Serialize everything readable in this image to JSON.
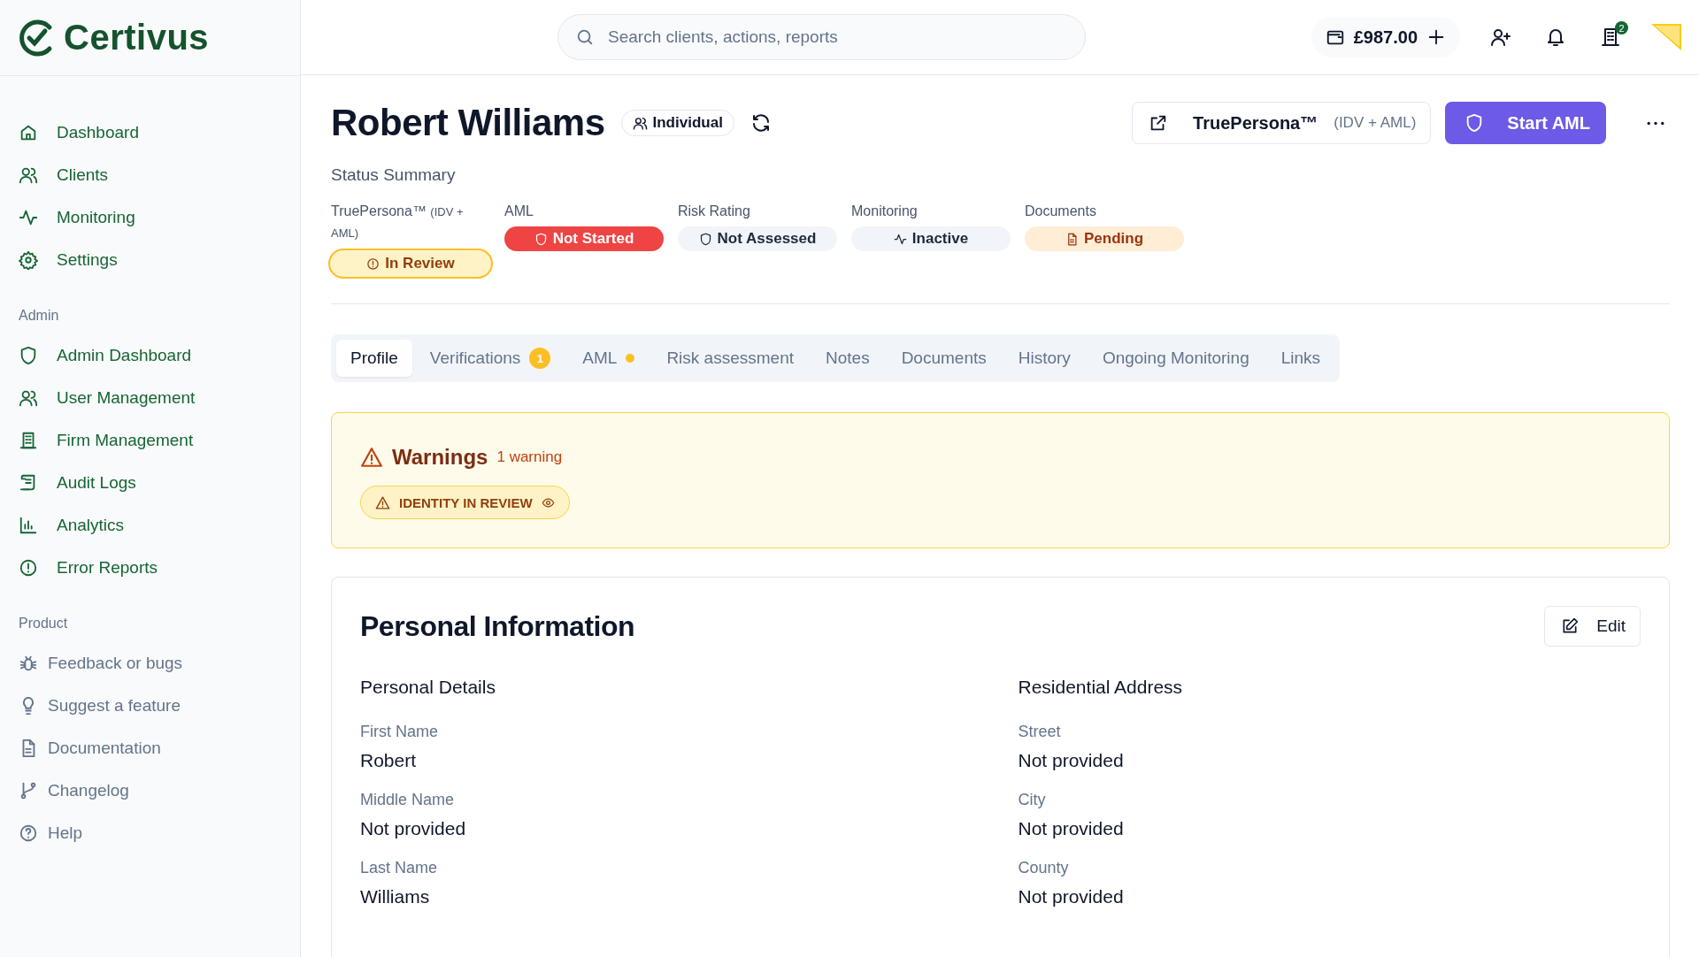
{
  "logo": {
    "text": "Certivus"
  },
  "sidebar": {
    "sections": [
      {
        "kind": "primary",
        "items": [
          {
            "label": "Dashboard"
          },
          {
            "label": "Clients"
          },
          {
            "label": "Monitoring"
          },
          {
            "label": "Settings"
          }
        ]
      },
      {
        "kind": "primary",
        "title": "Admin",
        "items": [
          {
            "label": "Admin Dashboard"
          },
          {
            "label": "User Management"
          },
          {
            "label": "Firm Management"
          },
          {
            "label": "Audit Logs"
          },
          {
            "label": "Analytics"
          },
          {
            "label": "Error Reports"
          }
        ]
      },
      {
        "kind": "secondary",
        "title": "Product",
        "items": [
          {
            "label": "Feedback or bugs"
          },
          {
            "label": "Suggest a feature"
          },
          {
            "label": "Documentation"
          },
          {
            "label": "Changelog"
          },
          {
            "label": "Help"
          }
        ]
      }
    ]
  },
  "topbar": {
    "search": {
      "placeholder": "Search clients, actions, reports"
    },
    "balance": "£987.00",
    "notification_count": "2"
  },
  "header": {
    "name": "Robert Williams",
    "type": "Individual",
    "truepersona": {
      "label": "TruePersona™",
      "note": "(IDV + AML)"
    },
    "primary_action": "Start AML"
  },
  "status_summary": {
    "title": "Status Summary",
    "items": [
      {
        "label": "TruePersona™",
        "note": "(IDV + AML)",
        "status": "In Review",
        "kind": "review"
      },
      {
        "label": "AML",
        "status": "Not Started",
        "kind": "danger"
      },
      {
        "label": "Risk Rating",
        "status": "Not Assessed",
        "kind": "neutral-shield"
      },
      {
        "label": "Monitoring",
        "status": "Inactive",
        "kind": "neutral-activity"
      },
      {
        "label": "Documents",
        "status": "Pending",
        "kind": "pending"
      }
    ]
  },
  "tabs": [
    {
      "label": "Profile",
      "selected": true,
      "dot": false
    },
    {
      "label": "Verifications",
      "selected": false,
      "badge": "1",
      "dot": false
    },
    {
      "label": "AML",
      "selected": false,
      "dot": true
    },
    {
      "label": "Risk assessment",
      "selected": false,
      "dot": false
    },
    {
      "label": "Notes",
      "selected": false,
      "dot": false
    },
    {
      "label": "Documents",
      "selected": false,
      "dot": false
    },
    {
      "label": "History",
      "selected": false,
      "dot": false
    },
    {
      "label": "Ongoing Monitoring",
      "selected": false,
      "dot": false
    },
    {
      "label": "Links",
      "selected": false,
      "dot": false
    }
  ],
  "warnings": {
    "title": "Warnings",
    "count": "1 warning",
    "tags": [
      {
        "text": "IDENTITY IN REVIEW"
      }
    ]
  },
  "personal_information": {
    "title": "Personal Information",
    "edit": "Edit",
    "sections": [
      {
        "title": "Personal Details",
        "fields": [
          {
            "label": "First Name",
            "value": "Robert"
          },
          {
            "label": "Middle Name",
            "value": "Not provided"
          },
          {
            "label": "Last Name",
            "value": "Williams"
          }
        ]
      },
      {
        "title": "Residential Address",
        "fields": [
          {
            "label": "Street",
            "value": "Not provided"
          },
          {
            "label": "City",
            "value": "Not provided"
          },
          {
            "label": "County",
            "value": "Not provided"
          }
        ]
      }
    ]
  }
}
